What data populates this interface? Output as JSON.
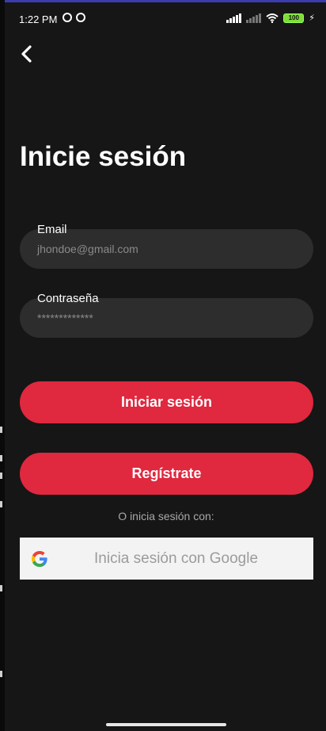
{
  "status_bar": {
    "time": "1:22 PM",
    "battery_level": "100"
  },
  "icons": {
    "back": "chevron-left-icon",
    "google": "google-g-icon",
    "whatsapp": "whatsapp-icon",
    "notification": "app-notification-icon",
    "wifi": "wifi-icon",
    "signal": "cellular-signal-icon",
    "charging": "charging-bolt-icon"
  },
  "page": {
    "title": "Inicie sesión"
  },
  "form": {
    "email_label": "Email",
    "email_value": "jhondoe@gmail.com",
    "password_label": "Contraseña",
    "password_value": "*************"
  },
  "buttons": {
    "login": "Iniciar sesión",
    "register": "Regístrate"
  },
  "alt_login": {
    "label": "O inicia sesión con:",
    "google": "Inicia sesión con Google"
  },
  "colors": {
    "accent": "#e0283f",
    "background": "#161616",
    "field": "#2d2d2d",
    "google_button": "#f3f3f3"
  }
}
